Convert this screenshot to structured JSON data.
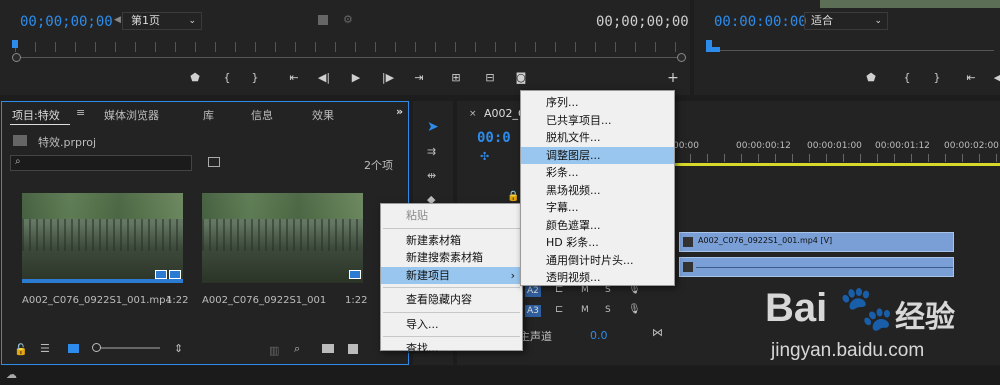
{
  "source_monitor": {
    "timecode_left": "00;00;00;00",
    "page_select": "第1页",
    "timecode_right": "00;00;00;00"
  },
  "program_monitor": {
    "timecode": "00:00:00:00",
    "fit_select": "适合"
  },
  "project_panel": {
    "tabs": [
      "项目:特效",
      "媒体浏览器",
      "库",
      "信息",
      "效果"
    ],
    "project_file": "特效.prproj",
    "item_count": "2个项",
    "clips": [
      {
        "name": "A002_C076_0922S1_001.mp4",
        "duration": "1:22"
      },
      {
        "name": "A002_C076_0922S1_001",
        "duration": "1:22"
      }
    ]
  },
  "context_menu": {
    "items": [
      {
        "label": "粘贴",
        "disabled": true
      },
      {
        "label": "新建素材箱"
      },
      {
        "label": "新建搜索素材箱"
      },
      {
        "label": "新建项目",
        "highlighted": true,
        "submenu": true
      },
      {
        "label": "查看隐藏内容"
      },
      {
        "label": "导入..."
      },
      {
        "label": "查找..."
      }
    ]
  },
  "submenu": {
    "items": [
      {
        "label": "序列..."
      },
      {
        "label": "已共享项目..."
      },
      {
        "label": "脱机文件..."
      },
      {
        "label": "调整图层...",
        "highlighted": true
      },
      {
        "label": "彩条..."
      },
      {
        "label": "黑场视频..."
      },
      {
        "label": "字幕..."
      },
      {
        "label": "颜色遮罩..."
      },
      {
        "label": "HD 彩条..."
      },
      {
        "label": "通用倒计时片头..."
      },
      {
        "label": "透明视频..."
      }
    ]
  },
  "timeline": {
    "tab": "A002_C",
    "timecode": "00:0",
    "ruler": [
      "00:00",
      "00:00:00:12",
      "00:00:01:00",
      "00:00:01:12",
      "00:00:02:00"
    ],
    "clip_label": "A002_C076_0922S1_001.mp4 [V]",
    "tracks": [
      "A2",
      "A3"
    ],
    "master_label": "主声道",
    "master_value": "0.0"
  },
  "watermark": {
    "brand": "Bai",
    "brand_cn": "经验",
    "url": "jingyan.baidu.com"
  },
  "colors": {
    "accent": "#2d8ceb",
    "menu_highlight": "#98c6ee",
    "clip": "#7a9fd6",
    "playhead_yellow": "#d8d82a"
  }
}
